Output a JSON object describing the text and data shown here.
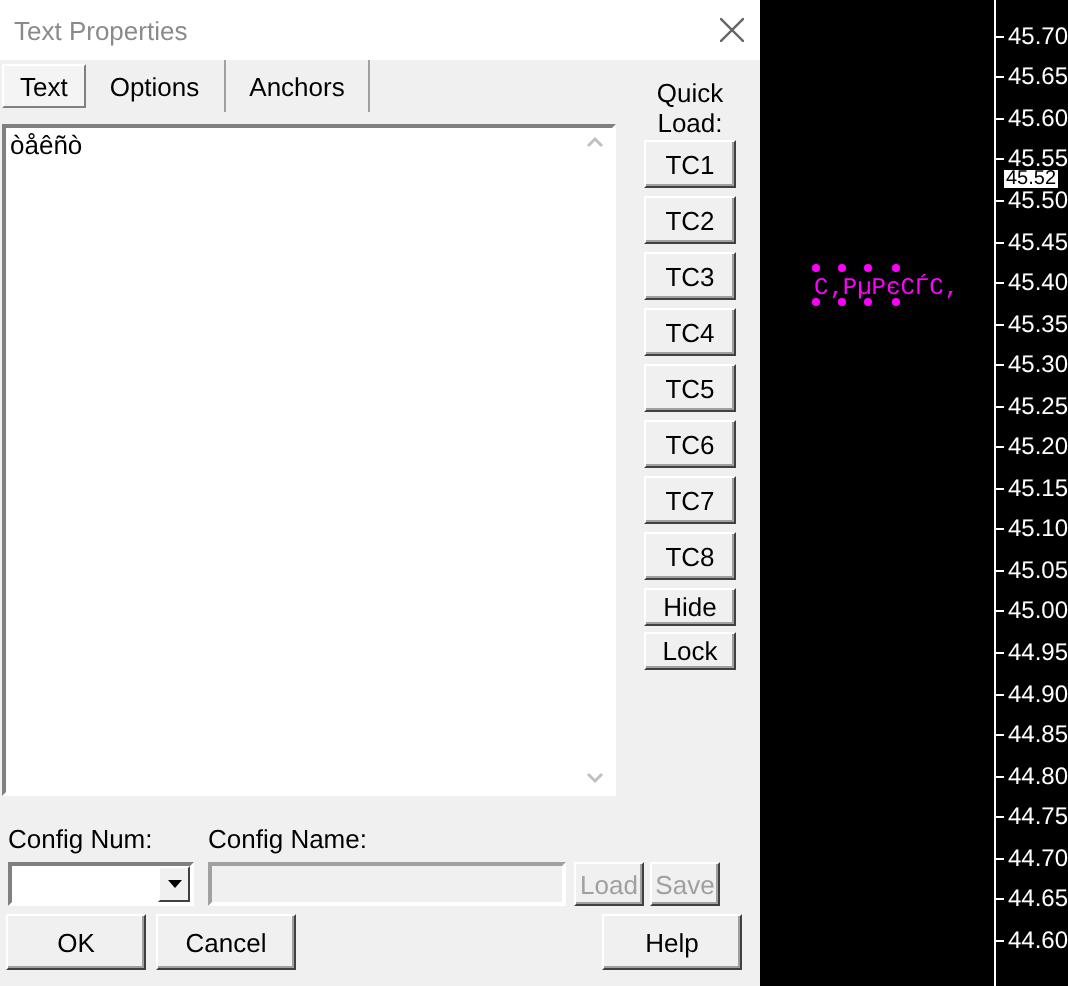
{
  "dialog": {
    "title": "Text Properties",
    "tabs": [
      {
        "label": "Text",
        "selected": true
      },
      {
        "label": "Options",
        "selected": false
      },
      {
        "label": "Anchors",
        "selected": false
      }
    ],
    "text_value": "òåêñò",
    "quick_load": {
      "label": "Quick Load:",
      "buttons": [
        "TC1",
        "TC2",
        "TC3",
        "TC4",
        "TC5",
        "TC6",
        "TC7",
        "TC8"
      ]
    },
    "side_buttons": [
      "Hide",
      "Lock"
    ],
    "config_num": {
      "label": "Config Num:"
    },
    "config_name": {
      "label": "Config Name:",
      "disabled": true
    },
    "config_buttons": [
      {
        "label": "Load",
        "disabled": true
      },
      {
        "label": "Save",
        "disabled": true
      }
    ],
    "buttons": [
      "OK",
      "Cancel",
      "Help"
    ]
  },
  "chart": {
    "text_object": "С‚РµРєСЃС‚",
    "price_labels": [
      "45.70",
      "45.65",
      "45.60",
      "45.55",
      "45.50",
      "45.45",
      "45.40",
      "45.35",
      "45.30",
      "45.25",
      "45.20",
      "45.15",
      "45.10",
      "45.05",
      "45.00",
      "44.95",
      "44.90",
      "44.85",
      "44.80",
      "44.75",
      "44.70",
      "44.65",
      "44.60"
    ],
    "current_price": "45.52"
  }
}
